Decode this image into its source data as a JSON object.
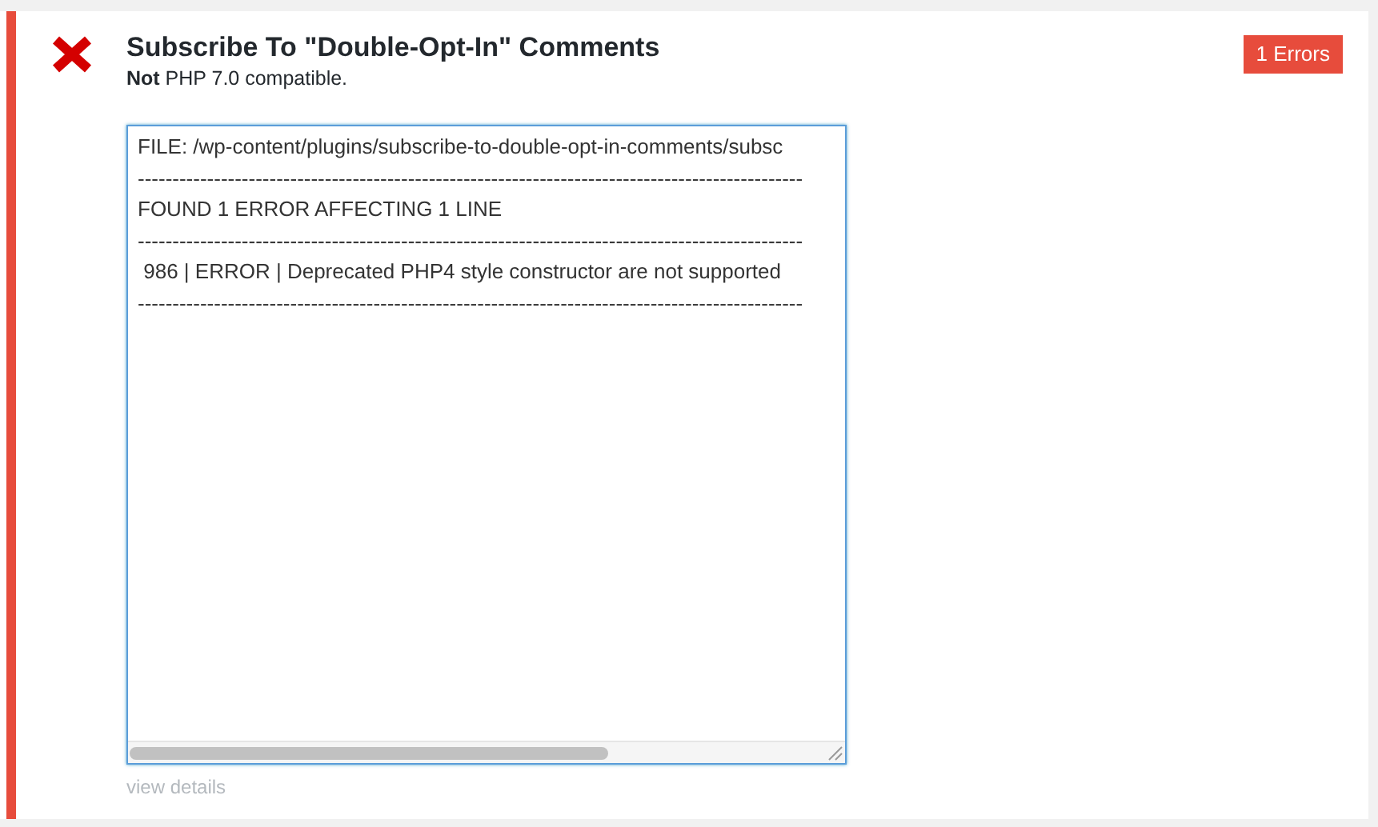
{
  "plugin": {
    "title": "Subscribe To \"Double-Opt-In\" Comments",
    "status": "**Not** PHP 7.0 compatible.",
    "badge": "1 Errors",
    "passed": false
  },
  "report": {
    "lines": [
      "FILE: /wp-content/plugins/subscribe-to-double-opt-in-comments/subsc",
      "------------------------------------------------------------------------------------------------",
      "FOUND 1 ERROR AFFECTING 1 LINE",
      "------------------------------------------------------------------------------------------------",
      " 986 | ERROR | Deprecated PHP4 style constructor are not supported",
      "------------------------------------------------------------------------------------------------"
    ]
  },
  "link": "view details"
}
